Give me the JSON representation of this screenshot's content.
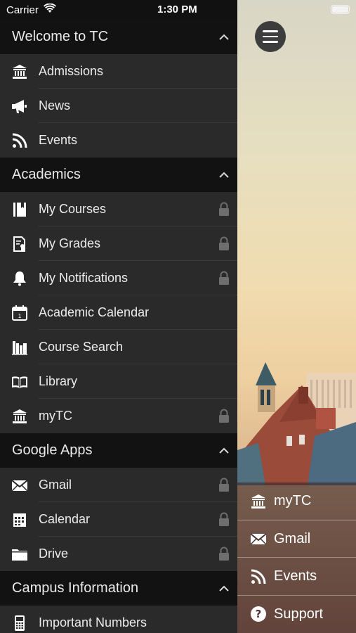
{
  "status_bar": {
    "carrier": "Carrier",
    "time": "1:30 PM"
  },
  "sections": [
    {
      "title": "Welcome to TC",
      "items": [
        {
          "label": "Admissions",
          "icon": "bank-icon",
          "locked": false
        },
        {
          "label": "News",
          "icon": "megaphone-icon",
          "locked": false
        },
        {
          "label": "Events",
          "icon": "rss-icon",
          "locked": false
        }
      ]
    },
    {
      "title": "Academics",
      "items": [
        {
          "label": "My Courses",
          "icon": "notebook-icon",
          "locked": true
        },
        {
          "label": "My Grades",
          "icon": "certificate-icon",
          "locked": true
        },
        {
          "label": "My Notifications",
          "icon": "bell-icon",
          "locked": true
        },
        {
          "label": "Academic Calendar",
          "icon": "calendar-icon",
          "locked": false
        },
        {
          "label": "Course Search",
          "icon": "books-icon",
          "locked": false
        },
        {
          "label": "Library",
          "icon": "open-book-icon",
          "locked": false
        },
        {
          "label": "myTC",
          "icon": "bank-icon",
          "locked": true
        }
      ]
    },
    {
      "title": "Google Apps",
      "items": [
        {
          "label": "Gmail",
          "icon": "envelope-icon",
          "locked": true
        },
        {
          "label": "Calendar",
          "icon": "grid-calendar-icon",
          "locked": true
        },
        {
          "label": "Drive",
          "icon": "folder-icon",
          "locked": true
        }
      ]
    },
    {
      "title": "Campus Information",
      "items": [
        {
          "label": "Important Numbers",
          "icon": "phone-icon",
          "locked": false
        }
      ]
    }
  ],
  "quick_links": [
    {
      "label": "myTC",
      "icon": "bank-icon"
    },
    {
      "label": "Gmail",
      "icon": "envelope-icon"
    },
    {
      "label": "Events",
      "icon": "rss-icon"
    },
    {
      "label": "Support",
      "icon": "question-circle-icon"
    }
  ],
  "colors": {
    "drawer_bg": "#2a2a2a",
    "header_bg": "#121212",
    "text": "#ececec",
    "lock": "#6e6e6e"
  }
}
